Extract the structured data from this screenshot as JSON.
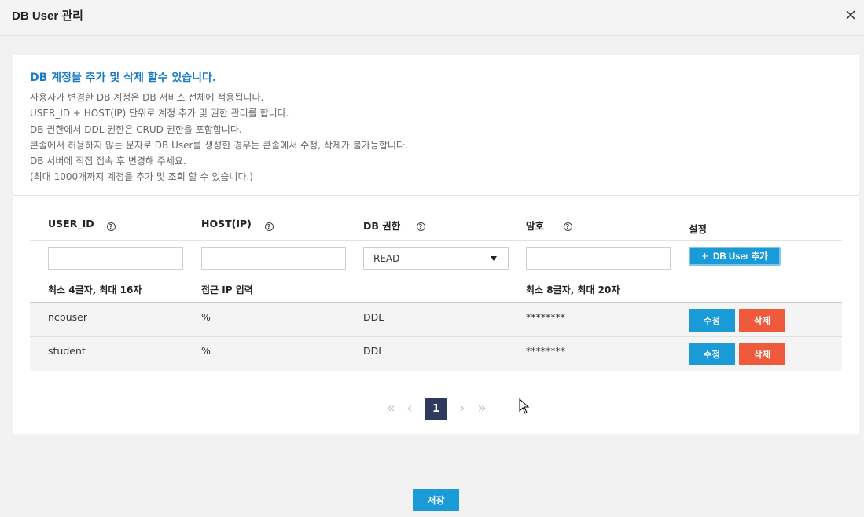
{
  "window": {
    "title": "DB User 관리"
  },
  "info": {
    "heading": "DB 계정을 추가 및 삭제 할수 있습니다.",
    "lines": [
      "사용자가 변경한 DB 계정은 DB 서비스 전체에 적용됩니다.",
      "USER_ID + HOST(IP) 단위로 계정 추가 및 권한 관리를 합니다.",
      "DB 권한에서 DDL 권한은 CRUD 권한을 포함합니다.",
      "콘솔에서 허용하지 않는 문자로 DB User를 생성한 경우는 콘솔에서 수정, 삭제가 불가능합니다.",
      "DB 서버에 직접 접속 후 변경해 주세요.",
      "(최대 1000개까지 계정을 추가 및 조회 할 수 있습니다.)"
    ]
  },
  "columns": {
    "user_id": "USER_ID",
    "host": "HOST(IP)",
    "privilege": "DB 권한",
    "password": "암호",
    "settings": "설정",
    "help_glyph": "?"
  },
  "form": {
    "user_id_value": "",
    "host_value": "",
    "privilege_selected": "READ",
    "password_value": "",
    "add_button": "DB User 추가",
    "plus_glyph": "+"
  },
  "hints": {
    "user_id": "최소 4글자, 최대 16자",
    "host": "접근 IP 입력",
    "password": "최소 8글자, 최대 20자"
  },
  "rows": [
    {
      "user_id": "ncpuser",
      "host": "%",
      "privilege": "DDL",
      "password": "********",
      "edit": "수정",
      "delete": "삭제"
    },
    {
      "user_id": "student",
      "host": "%",
      "privilege": "DDL",
      "password": "********",
      "edit": "수정",
      "delete": "삭제"
    }
  ],
  "pagination": {
    "first": "«",
    "prev": "‹",
    "current": "1",
    "next": "›",
    "last": "»"
  },
  "footer": {
    "save": "저장"
  },
  "colors": {
    "accent": "#1a9ad6",
    "danger": "#ef5a3c",
    "heading": "#1a7bc4",
    "page_active": "#2e3b5c"
  },
  "icons": [
    "close-icon",
    "help-icon",
    "dropdown-arrow-icon",
    "plus-icon",
    "double-chevron-left-icon",
    "chevron-left-icon",
    "chevron-right-icon",
    "double-chevron-right-icon",
    "mouse-cursor-icon"
  ]
}
